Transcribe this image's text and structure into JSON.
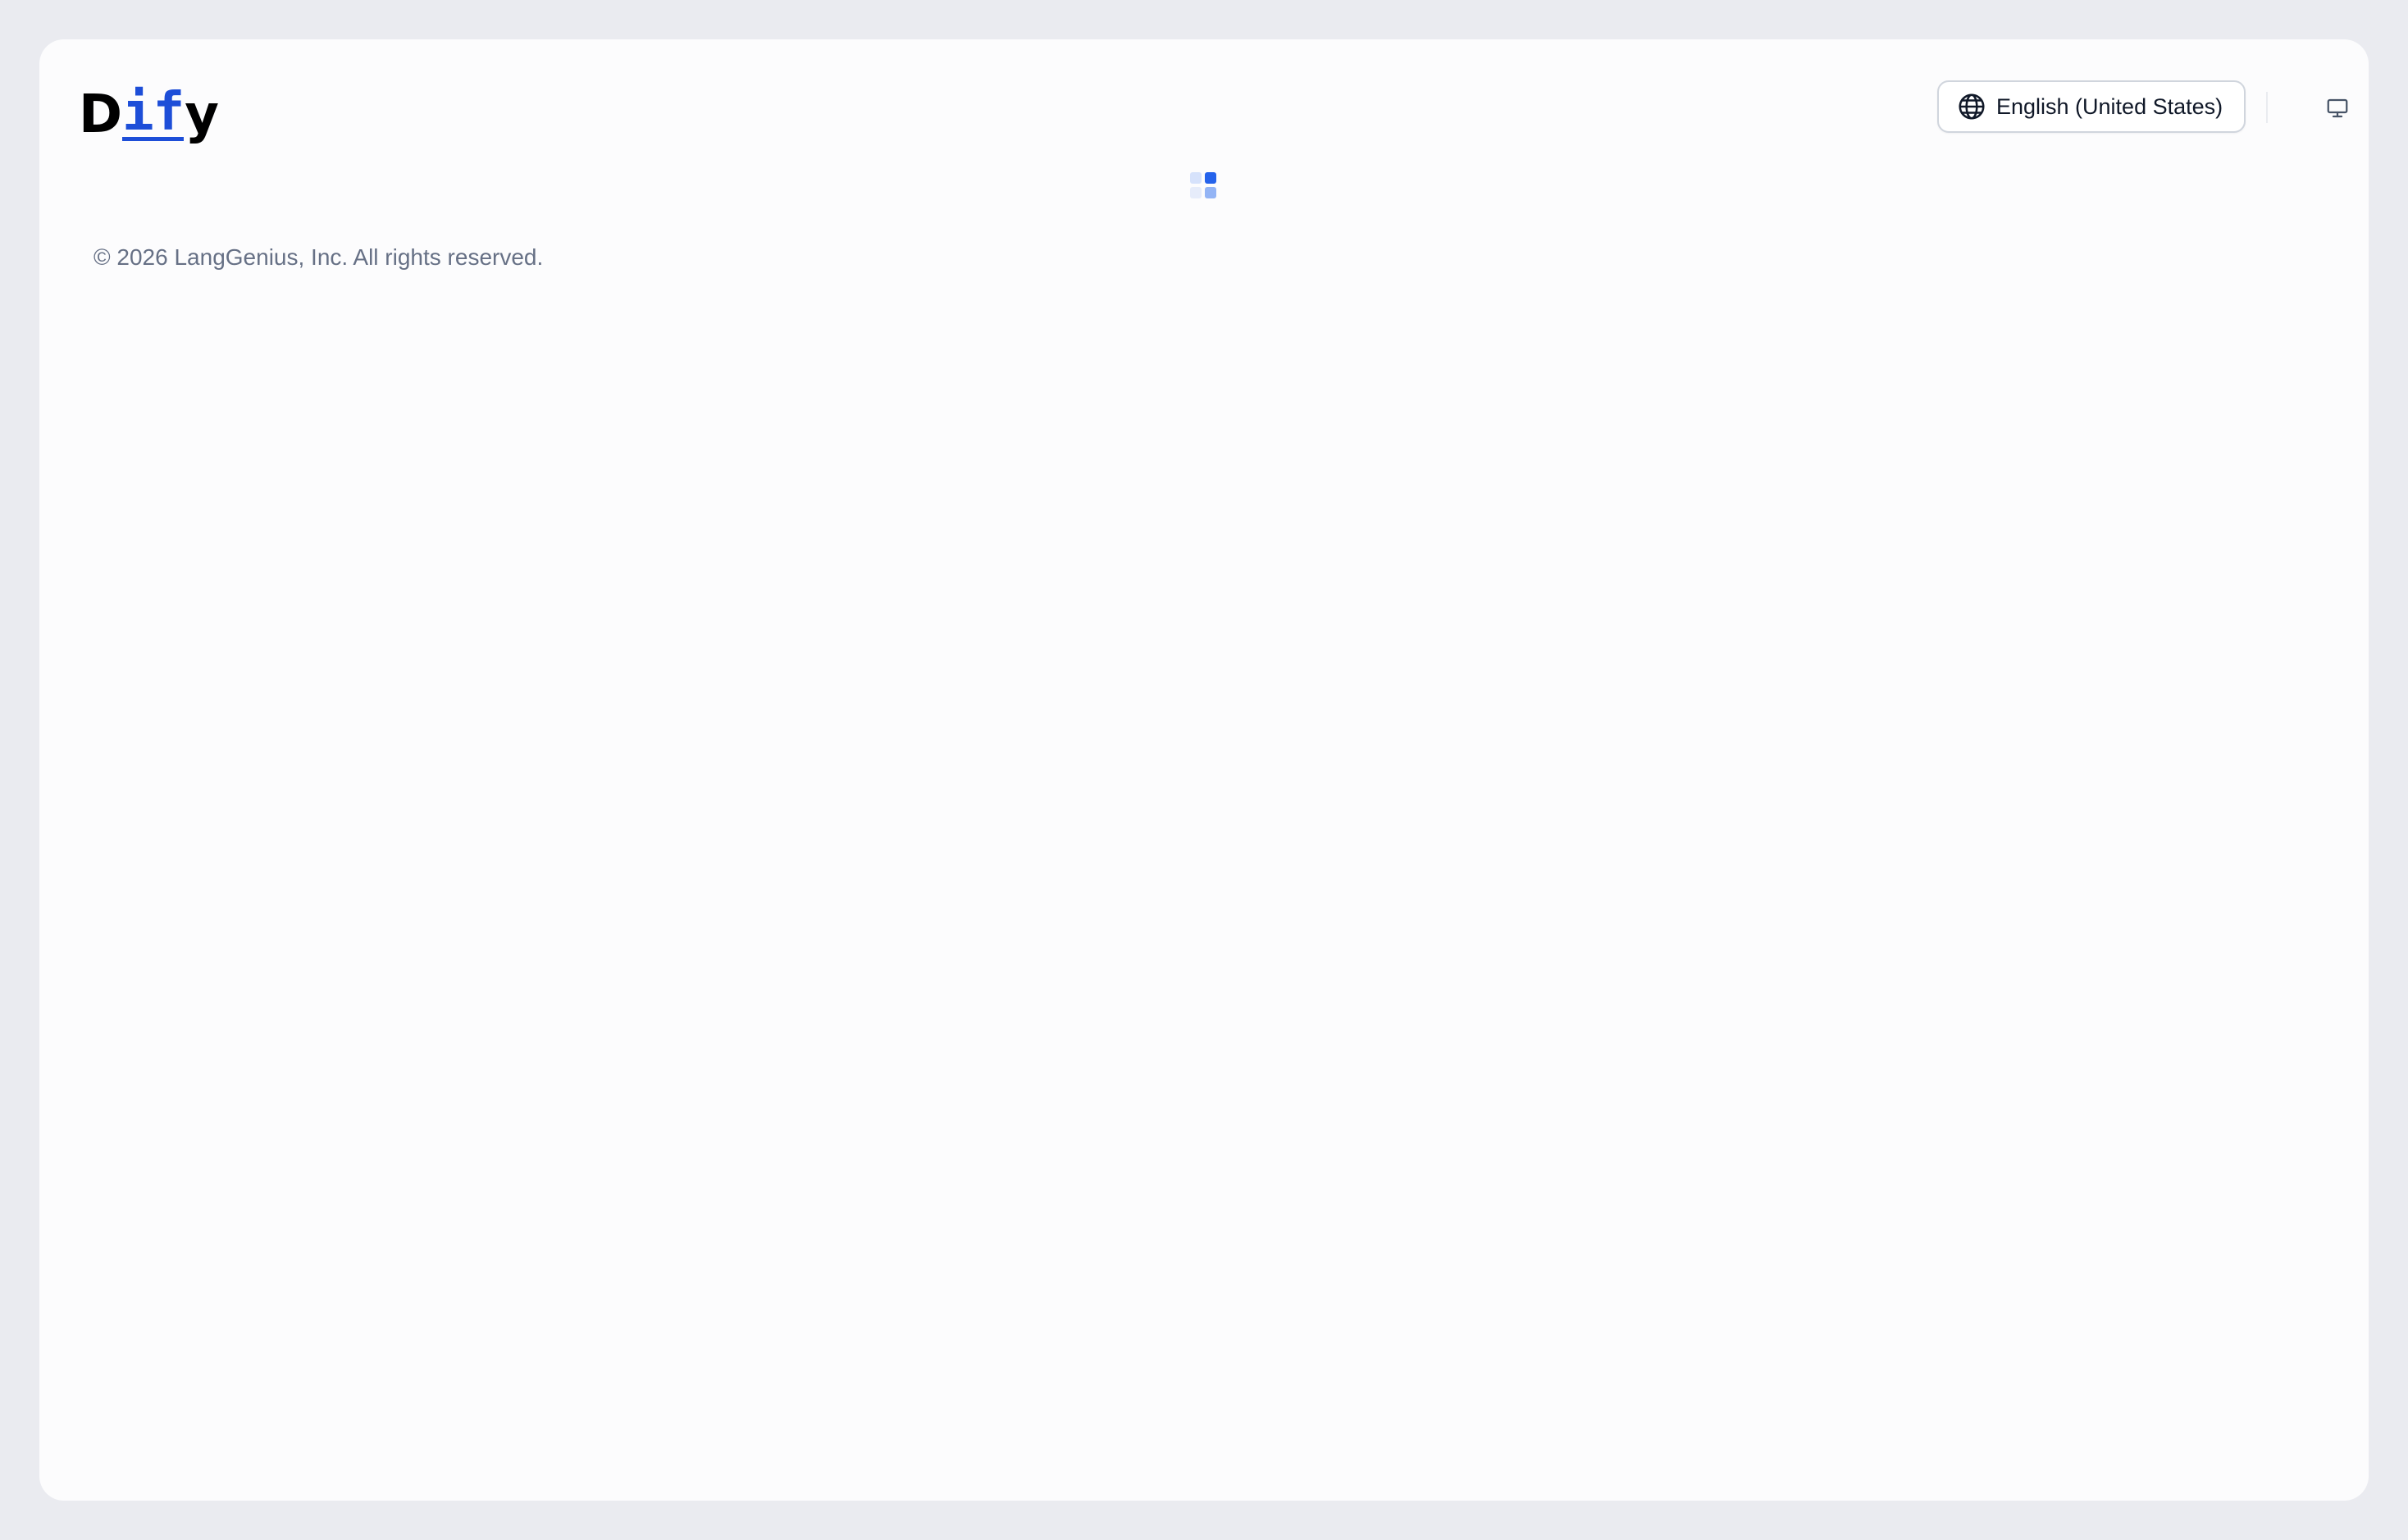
{
  "app": {
    "logo_prefix": "D",
    "logo_mid": "if",
    "logo_suffix": "y"
  },
  "header": {
    "language_label": "English (United States)",
    "language_icon": "globe-icon",
    "theme_icon": "monitor-icon"
  },
  "main": {
    "loading_icon": "loading-grid-icon"
  },
  "footer": {
    "copyright": "© 2026 LangGenius, Inc. All rights reserved."
  },
  "colors": {
    "background": "#eaebf0",
    "card": "#fcfcfd",
    "brand_blue": "#1d4ed8",
    "loader_primary": "#2563eb",
    "loader_mid": "#93b4f5",
    "loader_light": "#d6e2fb",
    "loader_faint": "#e6ecfa",
    "footer_text": "#667085"
  }
}
